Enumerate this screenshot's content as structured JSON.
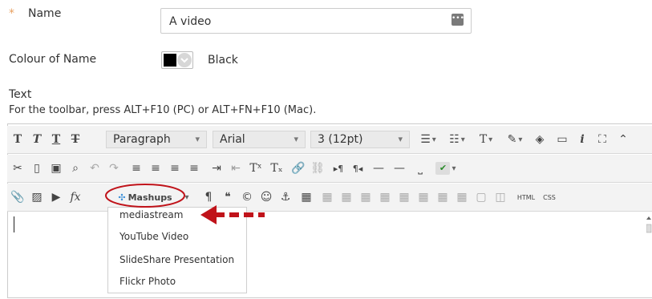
{
  "form": {
    "required_mark": "*",
    "name_label": "Name",
    "name_value": "A video",
    "input_icon": "ellipsis-icon",
    "colour_label": "Colour of Name",
    "colour_value": "Black",
    "colour_hex": "#000000",
    "text_label": "Text",
    "toolbar_hint": "For the toolbar, press ALT+F10 (PC) or ALT+FN+F10 (Mac)."
  },
  "toolbar": {
    "format_select": "Paragraph",
    "font_select": "Arial",
    "size_select": "3 (12pt)",
    "mashups_label": "Mashups",
    "html_label": "HTML",
    "css_label": "CSS"
  },
  "mashups_menu": {
    "items": [
      "mediastream",
      "YouTube Video",
      "SlideShare Presentation",
      "Flickr Photo"
    ]
  },
  "annotation": {
    "color": "#c0131a"
  },
  "colors": {
    "toolbar_bg": "#f3f3f3",
    "border": "#cccccc",
    "required": "#e8a060"
  }
}
